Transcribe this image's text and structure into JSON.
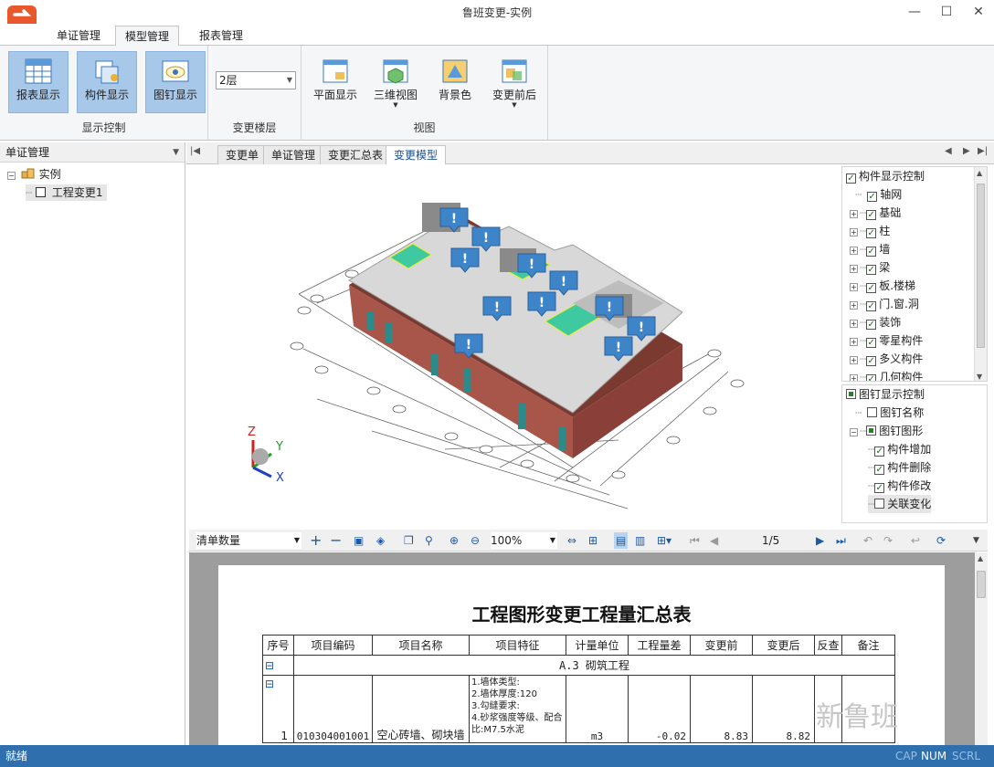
{
  "window": {
    "title": "鲁班变更-实例",
    "min": "—",
    "max": "☐",
    "close": "✕"
  },
  "ribbon_tabs": [
    "单证管理",
    "模型管理",
    "报表管理"
  ],
  "ribbon": {
    "display_group": {
      "label": "显示控制",
      "buttons": [
        "报表显示",
        "构件显示",
        "图钉显示"
      ]
    },
    "floor_group": {
      "label": "变更楼层",
      "selected": "2层"
    },
    "view_group": {
      "label": "视图",
      "buttons": [
        "平面显示",
        "三维视图",
        "背景色",
        "变更前后"
      ]
    }
  },
  "left_panel": {
    "title": "单证管理",
    "tree": {
      "root": "实例",
      "child": "工程变更1"
    }
  },
  "doc_tabs": [
    "变更单",
    "单证管理",
    "变更汇总表",
    "变更模型"
  ],
  "component_tree": {
    "title": "构件显示控制",
    "items": [
      "轴网",
      "基础",
      "柱",
      "墙",
      "梁",
      "板.楼梯",
      "门.窗.洞",
      "装饰",
      "零星构件",
      "多义构件",
      "几何构件"
    ]
  },
  "pin_tree": {
    "title": "图钉显示控制",
    "items": [
      "图钉名称",
      "图钉图形"
    ],
    "sub": [
      "构件增加",
      "构件删除",
      "构件修改",
      "关联变化"
    ]
  },
  "axes": {
    "x": "X",
    "y": "Y",
    "z": "Z"
  },
  "pin_mark": "!",
  "report_toolbar": {
    "filter": "清单数量",
    "zoom": "100%",
    "page": "1/5"
  },
  "report": {
    "title": "工程图形变更工程量汇总表",
    "headers": [
      "序号",
      "项目编码",
      "项目名称",
      "项目特征",
      "计量单位",
      "工程量差",
      "变更前",
      "变更后",
      "反查",
      "备注"
    ],
    "group": "A.3 砌筑工程",
    "row": {
      "no": "1",
      "code": "010304001001",
      "name": "空心砖墙、砌块墙",
      "feature": "1.墙体类型:\n2.墙体厚度:120\n3.勾缝要求:\n4.砂浆强度等级、配合比:M7.5水泥",
      "unit": "m3",
      "diff": "-0.02",
      "before": "8.83",
      "after": "8.82"
    },
    "expander": "⊟"
  },
  "status": {
    "left": "就绪",
    "caps": "CAP",
    "num": "NUM",
    "scrl": "SCRL"
  },
  "watermark": "新鲁班",
  "colors": {
    "accent": "#2f6fad",
    "selected": "#a8c8ea"
  }
}
